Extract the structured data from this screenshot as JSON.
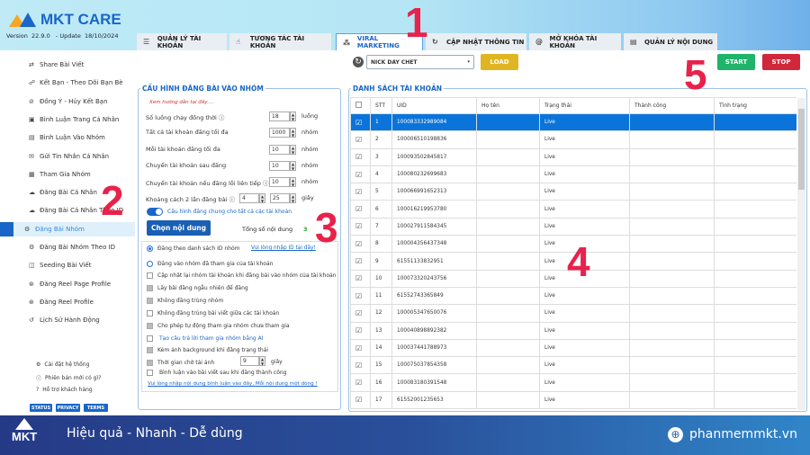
{
  "app": {
    "brand": "MKT CARE",
    "version": "Version  22.9.0   - Update  18/10/2024"
  },
  "tabs": [
    {
      "label": "QUẢN LÝ TÀI KHOẢN",
      "icon": "list-icon"
    },
    {
      "label": "TƯƠNG TÁC TÀI KHOẢN",
      "icon": "hand-icon"
    },
    {
      "label": "VIRAL MARKETING",
      "icon": "network-icon",
      "active": true
    },
    {
      "label": "CẬP NHẬT THÔNG TIN",
      "icon": "refresh-user-icon"
    },
    {
      "label": "MỞ KHÓA TÀI KHOẢN",
      "icon": "fingerprint-icon"
    },
    {
      "label": "QUẢN LÝ NỘI DUNG",
      "icon": "document-icon"
    }
  ],
  "sidebar": {
    "items": [
      {
        "label": "Share Bài Viết",
        "icon": "⇄"
      },
      {
        "label": "Kết Bạn - Theo Dõi Bạn Bè",
        "icon": "☍"
      },
      {
        "label": "Đồng Ý - Hủy Kết Bạn",
        "icon": "⊘"
      },
      {
        "label": "Bình Luận Trang Cá Nhân",
        "icon": "▣"
      },
      {
        "label": "Bình Luận Vào Nhóm",
        "icon": "▤"
      },
      {
        "label": "Gửi Tin Nhắn Cá Nhân",
        "icon": "✉"
      },
      {
        "label": "Tham Gia Nhóm",
        "icon": "▦"
      },
      {
        "label": "Đăng Bài Cá Nhân",
        "icon": "☁"
      },
      {
        "label": "Đăng Bài Cá Nhân Theo ID",
        "icon": "☁"
      },
      {
        "label": "Đăng Bài Nhóm",
        "icon": "⚙",
        "active": true
      },
      {
        "label": "Đăng Bài Nhóm Theo ID",
        "icon": "⚙"
      },
      {
        "label": "Seeding Bài Viết",
        "icon": "◫"
      },
      {
        "label": "Đăng Reel Page Profile",
        "icon": "⊛"
      },
      {
        "label": "Đăng Reel Profile",
        "icon": "⊛"
      },
      {
        "label": "Lịch Sử Hành Động",
        "icon": "↺"
      }
    ],
    "bottom": [
      {
        "label": "Cài đặt hệ thống",
        "icon": "⚙"
      },
      {
        "label": "Phiên bản mới có gì?",
        "icon": "ⓘ"
      },
      {
        "label": "Hỗ trợ khách hàng",
        "icon": "?"
      }
    ],
    "buttons": [
      "STATUS",
      "PRIVACY",
      "TERMS"
    ]
  },
  "toolbar": {
    "select_value": "NICK DAY CHET",
    "load": "LOAD",
    "start": "START",
    "stop": "STOP"
  },
  "config": {
    "title": "CẤU HÌNH ĐĂNG BÀI VÀO NHÓM",
    "guide": "Xem hướng dẫn tại đây ...",
    "fields": [
      {
        "label": "Số luồng chạy đồng thời",
        "value": "18",
        "unit": "luồng",
        "help": true
      },
      {
        "label": "Tất cả tài khoản đăng tối đa",
        "value": "1000",
        "unit": "nhóm"
      },
      {
        "label": "Mỗi tài khoản đăng tối đa",
        "value": "10",
        "unit": "nhóm"
      },
      {
        "label": "Chuyển tài khoản sau đăng",
        "value": "10",
        "unit": "nhóm"
      },
      {
        "label": "Chuyển tài khoản nếu đăng lỗi liên tiếp",
        "value": "10",
        "unit": "nhóm",
        "help": true
      }
    ],
    "interval": {
      "label": "Khoảng cách 2 lần đăng bài",
      "from": "4",
      "to": "25",
      "unit": "giây"
    },
    "toggle_label": "Cấu hình đăng chung cho tất cả các tài khoản",
    "toggle_on": true,
    "choose_content": "Chọn nội dung",
    "total_label": "Tổng số nội dung",
    "total_value": "3",
    "radio1": "Đăng theo danh sách ID nhóm",
    "radio1_link": "Vui lòng nhập ID tại đây!",
    "radio2": "Đăng vào nhóm đã tham gia của tài khoản",
    "options": [
      {
        "label": "Cập nhật lại nhóm tài khoản khi đăng bài vào nhóm của tài khoản",
        "checked": false
      },
      {
        "label": "Lấy bài đăng ngẫu nhiên để đăng",
        "checked": true
      },
      {
        "label": "Không đăng trùng nhóm",
        "checked": true
      },
      {
        "label": "Không đăng trùng bài viết giữa các tài khoản",
        "checked": false
      },
      {
        "label": "Cho phép tự động tham gia nhóm chưa tham gia",
        "checked": true
      },
      {
        "label": "Tạo câu trả lời tham gia nhóm bằng AI",
        "checked": false,
        "link": true
      },
      {
        "label": "Kèm ảnh background khi đăng trạng thái",
        "checked": true
      }
    ],
    "wait": {
      "label": "Thời gian chờ tải ảnh",
      "value": "9",
      "unit": "giây",
      "checked": true
    },
    "comment": {
      "label": "Bình luận vào bài viết sau khi đăng thành công",
      "checked": false
    },
    "comment_link": "Vui lòng nhập nội dung bình luận vào đây, Mỗi nội dung một dòng !"
  },
  "accounts": {
    "title": "DANH SÁCH TÀI KHOẢN",
    "columns": [
      "",
      "STT",
      "UID",
      "Họ tên",
      "Trạng thái",
      "Thành công",
      "Tình trạng"
    ],
    "rows": [
      [
        "1",
        "100083332989084",
        "Live"
      ],
      [
        "2",
        "100006510198836",
        "Live"
      ],
      [
        "3",
        "100093502845817",
        "Live"
      ],
      [
        "4",
        "100080232699683",
        "Live"
      ],
      [
        "5",
        "100066991652313",
        "Live"
      ],
      [
        "6",
        "100016219953780",
        "Live"
      ],
      [
        "7",
        "100027911584345",
        "Live"
      ],
      [
        "8",
        "100004356437348",
        "Live"
      ],
      [
        "9",
        "61551133832951",
        "Live"
      ],
      [
        "10",
        "100073320243756",
        "Live"
      ],
      [
        "11",
        "61552743365849",
        "Live"
      ],
      [
        "12",
        "100005347650076",
        "Live"
      ],
      [
        "13",
        "100040898892382",
        "Live"
      ],
      [
        "14",
        "100037441788973",
        "Live"
      ],
      [
        "15",
        "100075037854358",
        "Live"
      ],
      [
        "16",
        "100083180391548",
        "Live"
      ],
      [
        "17",
        "61552001235653",
        "Live"
      ]
    ]
  },
  "annotations": [
    "1",
    "2",
    "3",
    "4",
    "5"
  ],
  "footer": {
    "logo": "MKT",
    "slogan": "Hiệu quả - Nhanh - Dễ dùng",
    "website": "phanmemmkt.vn"
  },
  "colors": {
    "accent": "#1a66c8",
    "load": "#e0b522",
    "start": "#1fb36b",
    "stop": "#d0283a",
    "annotation": "#e8224a",
    "selected_row": "#0a74da"
  }
}
